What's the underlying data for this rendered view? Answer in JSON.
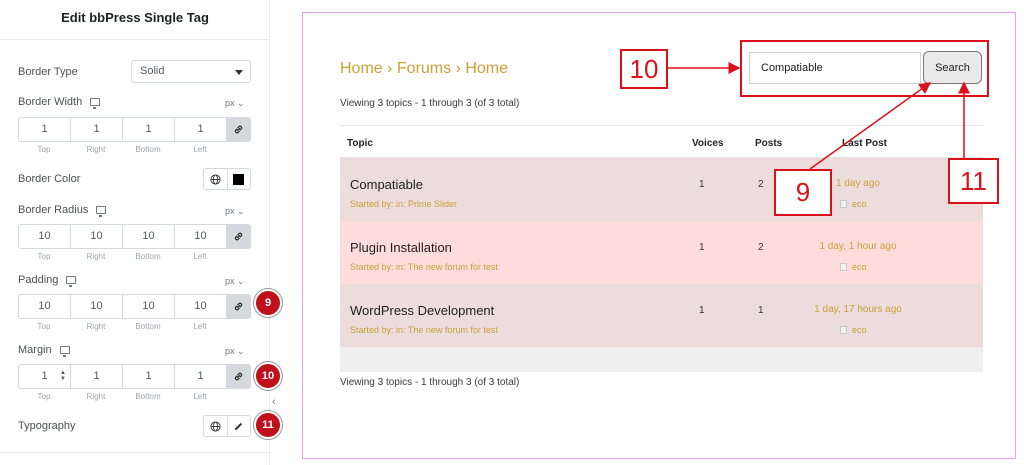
{
  "panel": {
    "title": "Edit bbPress Single Tag",
    "border_type": {
      "label": "Border Type",
      "value": "Solid"
    },
    "border_width": {
      "label": "Border Width",
      "unit": "px",
      "values": [
        "1",
        "1",
        "1",
        "1"
      ]
    },
    "border_color": {
      "label": "Border Color",
      "color": "#000000"
    },
    "border_radius": {
      "label": "Border Radius",
      "unit": "px",
      "values": [
        "10",
        "10",
        "10",
        "10"
      ]
    },
    "padding": {
      "label": "Padding",
      "unit": "px",
      "values": [
        "10",
        "10",
        "10",
        "10"
      ]
    },
    "margin": {
      "label": "Margin",
      "unit": "px",
      "values": [
        "1",
        "1",
        "1",
        "1"
      ]
    },
    "typography": {
      "label": "Typography"
    },
    "dim_labels": [
      "Top",
      "Right",
      "Bottom",
      "Left"
    ],
    "badges": [
      "9",
      "10",
      "11"
    ]
  },
  "preview": {
    "breadcrumb": "Home › Forums › Home",
    "viewing_top": "Viewing 3 topics - 1 through 3 (of 3 total)",
    "viewing_bottom": "Viewing 3 topics - 1 through 3 (of 3 total)",
    "search": {
      "value": "Compatiable",
      "button": "Search"
    },
    "columns": {
      "topic": "Topic",
      "voices": "Voices",
      "posts": "Posts",
      "last_post": "Last Post"
    },
    "rows": [
      {
        "title": "Compatiable",
        "meta": "Started by: in: Prime Slider",
        "voices": "1",
        "posts": "2",
        "last": "1 day ago",
        "author": "eco"
      },
      {
        "title": "Plugin Installation",
        "meta": "Started by: in: The new forum for test",
        "voices": "1",
        "posts": "2",
        "last": "1 day, 1 hour ago",
        "author": "eco"
      },
      {
        "title": "WordPress Development",
        "meta": "Started by: in: The new forum for test",
        "voices": "1",
        "posts": "1",
        "last": "1 day, 17 hours ago",
        "author": "eco"
      }
    ],
    "callouts": {
      "c10": "10",
      "c9": "9",
      "c11": "11"
    }
  },
  "colors": {
    "accent_gold": "#c9a23a",
    "annotation_red": "#d9111b",
    "badge_red": "#c0101c",
    "row_a": "#ecdcdc",
    "row_b": "#ffdcdc"
  },
  "icons": [
    "chevron-down-icon",
    "monitor-icon",
    "link-icon",
    "globe-icon",
    "pencil-icon",
    "collapse-arrow-icon"
  ]
}
